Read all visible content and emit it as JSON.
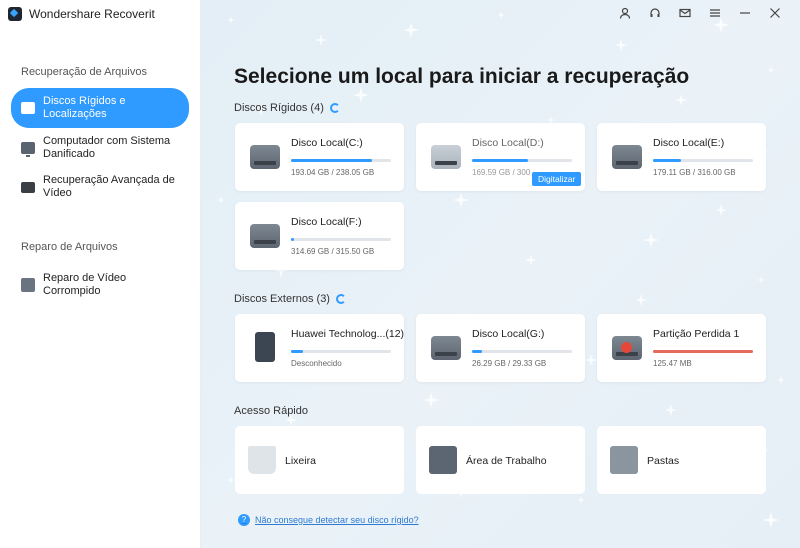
{
  "app": {
    "title": "Wondershare Recoverit"
  },
  "sidebar": {
    "section1": "Recuperação de Arquivos",
    "items": [
      {
        "label": "Discos Rígidos e Localizações",
        "icon": "drive-icon"
      },
      {
        "label": "Computador com Sistema Danificado",
        "icon": "computer-icon"
      },
      {
        "label": "Recuperação Avançada de Vídeo",
        "icon": "video-camera-icon"
      }
    ],
    "section2": "Reparo de Arquivos",
    "repair": {
      "label": "Reparo de Vídeo Corrompido",
      "icon": "video-repair-icon"
    }
  },
  "main": {
    "title": "Selecione um local para iniciar a recuperação",
    "hard_disks_label": "Discos Rígidos (4)",
    "external_label": "Discos Externos (3)",
    "quick_label": "Acesso Rápido",
    "scan_label": "Digitalizar",
    "help_text": "Não consegue detectar seu disco rígido?",
    "hard_disks": [
      {
        "name": "Disco Local(C:)",
        "size": "193.04 GB / 238.05 GB",
        "used": 0.81
      },
      {
        "name": "Disco Local(D:)",
        "size": "169.59 GB / 300",
        "used": 0.56
      },
      {
        "name": "Disco Local(E:)",
        "size": "179.11 GB / 316.00 GB",
        "used": 0.28
      },
      {
        "name": "Disco Local(F:)",
        "size": "314.69 GB / 315.50 GB",
        "used": 0.03
      }
    ],
    "external": [
      {
        "name": "Huawei Technolog...(12)",
        "size": "Desconhecido",
        "used": 0.12
      },
      {
        "name": "Disco Local(G:)",
        "size": "26.29 GB / 29.33 GB",
        "used": 0.1
      },
      {
        "name": "Partição Perdida 1",
        "size": "125.47 MB",
        "used": 1.0
      }
    ],
    "quick": [
      {
        "label": "Lixeira",
        "icon": "recycle-bin-icon"
      },
      {
        "label": "Área de Trabalho",
        "icon": "desktop-icon"
      },
      {
        "label": "Pastas",
        "icon": "folder-icon"
      }
    ]
  },
  "colors": {
    "accent": "#2f9aff",
    "danger": "#e46a5a"
  }
}
